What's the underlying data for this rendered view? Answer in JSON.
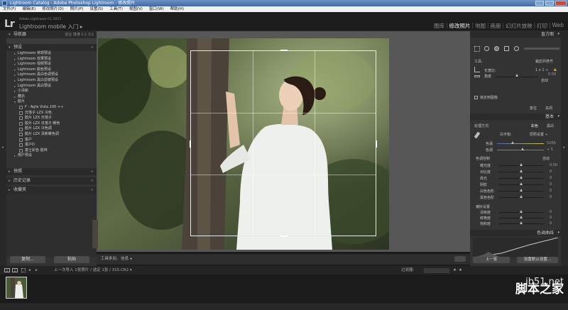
{
  "window": {
    "title": "Lightroom Catalog - Adobe Photoshop Lightroom - 修改照片"
  },
  "menu": [
    "文件(F)",
    "编辑(E)",
    "修改照片(D)",
    "照片(P)",
    "设置(S)",
    "工具(T)",
    "视图(V)",
    "窗口(W)",
    "帮助(H)"
  ],
  "identity": {
    "logo": "Lr",
    "small": "Adobe Lightroom CC 2015",
    "mobile": "Lightroom mobile 入门 ▸"
  },
  "modules": [
    {
      "label": "图库",
      "active": false
    },
    {
      "label": "修改照片",
      "active": true
    },
    {
      "label": "地图",
      "active": false
    },
    {
      "label": "画册",
      "active": false
    },
    {
      "label": "幻灯片放映",
      "active": false
    },
    {
      "label": "打印",
      "active": false
    },
    {
      "label": "Web",
      "active": false
    }
  ],
  "left": {
    "navigator": {
      "title": "导航器",
      "zoom": "适合  填满  1:1  3:1"
    },
    "presets": {
      "title": "预设"
    },
    "preset_items": [
      {
        "label": "Lightroom 常规预设",
        "level": 1
      },
      {
        "label": "Lightroom 效果预设",
        "level": 1
      },
      {
        "label": "Lightroom 视频预设",
        "level": 1
      },
      {
        "label": "Lightroom 颜色预设",
        "level": 1
      },
      {
        "label": "Lightroom 黑白色调预设",
        "level": 1
      },
      {
        "label": "Lightroom 黑白滤镜预设",
        "level": 1
      },
      {
        "label": "Lightroom 黑白预设",
        "level": 1
      },
      {
        "label": "小清新",
        "level": 1
      },
      {
        "label": "糖衣",
        "level": 1
      },
      {
        "label": "胶片",
        "level": 1,
        "open": true
      },
      {
        "label": "F - Agfa Vista 100 ++",
        "level": 2
      },
      {
        "label": "日落子 LZX 冷色",
        "level": 2
      },
      {
        "label": "胶片 LZX 日落子",
        "level": 2
      },
      {
        "label": "胶片 LZX 日落子 暖色",
        "level": 2
      },
      {
        "label": "胶片 LZX 冷色调",
        "level": 2
      },
      {
        "label": "胶片 LZX 清新暖色调",
        "level": 2
      },
      {
        "label": "富户",
        "level": 2
      },
      {
        "label": "富户D",
        "level": 2
      },
      {
        "label": "富士彩色 胶林",
        "level": 2
      },
      {
        "label": "用户预设",
        "level": 1
      }
    ],
    "snapshots": "快照",
    "history": "历史记录",
    "collections": "收藏夹",
    "copy_button": "复制...",
    "paste_button": "粘贴"
  },
  "toolbar": {
    "label": "工具条加:",
    "value": "信息 ◂"
  },
  "right": {
    "histogram_title": "直方图",
    "tool_label": "工具:",
    "tool_value": "裁剪并修齐",
    "aspect_label": "长宽比:",
    "aspect_value": "1 x 1 ÷",
    "angle_label": "角度",
    "angle_value": "0.00",
    "auto": "自动",
    "constrain": "锁定到图像",
    "reset": "复位",
    "close": "关闭",
    "basic_title": "基本",
    "treatment_label": "处理方式:",
    "color": "彩色",
    "bw": "黑白",
    "wb_label": "白平衡:",
    "wb_value": "原照设置 ÷",
    "temp_label": "色温",
    "temp_value": "5200",
    "tint_label": "色调",
    "tint_value": "+ 5",
    "tone_label": "色调控制",
    "tone_auto": "自动",
    "sliders": [
      {
        "label": "曝光度",
        "value": "0.00"
      },
      {
        "label": "对比度",
        "value": "0"
      },
      {
        "label": "高光",
        "value": "0"
      },
      {
        "label": "阴影",
        "value": "0"
      },
      {
        "label": "白色色阶",
        "value": "0"
      },
      {
        "label": "黑色色阶",
        "value": "0"
      }
    ],
    "presence_label": "偏好设置",
    "presence": [
      {
        "label": "清晰度",
        "value": "0"
      },
      {
        "label": "鲜艳度",
        "value": "0"
      },
      {
        "label": "饱和度",
        "value": "0"
      }
    ],
    "tone_curve_title": "色调曲线",
    "prev_button": "上一张",
    "reset_button": "设置默认设置..."
  },
  "film": {
    "nav": "上一次导入  1张照片 / 选定 1张 / 315.CR2 ▾",
    "filter_label": "过滤器:"
  },
  "watermark": {
    "url": "jb51.net",
    "text": "脚本之家"
  }
}
